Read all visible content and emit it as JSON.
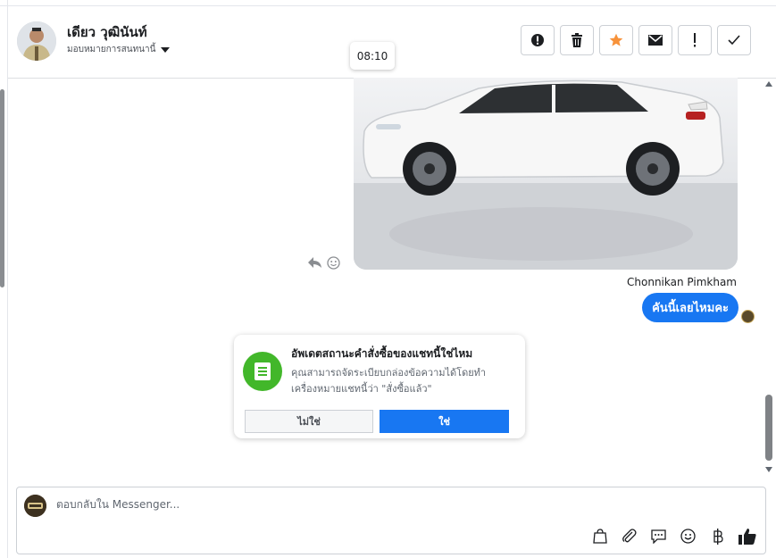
{
  "header": {
    "contact_name": "เดียว วุฒินันท์",
    "assign_label": "มอบหมายการสนทนานี้",
    "actions": [
      "spam-icon",
      "trash-icon",
      "star-icon",
      "envelope-icon",
      "exclamation-icon",
      "check-icon"
    ]
  },
  "timestamp": "08:10",
  "conversation": {
    "sender_name": "Chonnikan Pimkham",
    "message": "คันนี้เลยไหมคะ"
  },
  "order_card": {
    "title": "อัพเดตสถานะคำสั่งซื้อของแชทนี้ใช่ไหม",
    "body": "คุณสามารถจัดระเบียบกล่องข้อความได้โดยทำเครื่องหมายแชทนี้ว่า \"สั่งซื้อแล้ว\"",
    "no_label": "ไม่ใช่",
    "yes_label": "ใช่"
  },
  "composer": {
    "placeholder": "ตอบกลับใน Messenger..."
  },
  "colors": {
    "accent": "#1877f2",
    "star": "#f7923a",
    "order_icon": "#42b72a"
  }
}
